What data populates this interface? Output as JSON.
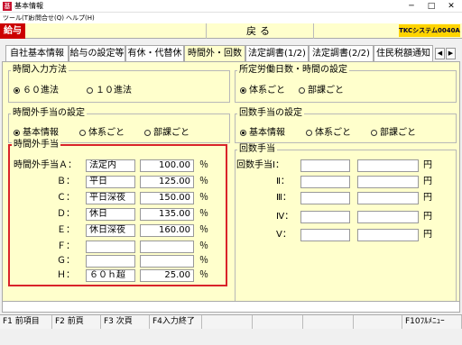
{
  "window": {
    "title": "基本情報",
    "minimize": "─",
    "maximize": "□",
    "close": "✕"
  },
  "menu": {
    "items": [
      "ツール(T)",
      "お問合せ(Q)",
      "ヘルプ(H)"
    ]
  },
  "toolbar": {
    "tag": "給与",
    "back": "戻る",
    "brand": "TKCシステム0040A"
  },
  "tabs": [
    "自社基本情報",
    "給与の設定等",
    "有休・代替休",
    "時間外・回数",
    "法定調書(1/2)",
    "法定調書(2/2)",
    "住民税額通知"
  ],
  "tab_active": "時間外・回数",
  "tab_arrows": {
    "left": "◀",
    "right": "▶"
  },
  "time_input": {
    "title": "時間入力方法",
    "options": [
      {
        "label": "６０進法",
        "selected": true
      },
      {
        "label": "１０進法",
        "selected": false
      }
    ]
  },
  "prescribed": {
    "title": "所定労働日数・時間の設定",
    "options": [
      {
        "label": "体系ごと",
        "selected": true
      },
      {
        "label": "部課ごと",
        "selected": false
      }
    ]
  },
  "overtime_setting": {
    "title": "時間外手当の設定",
    "options": [
      {
        "label": "基本情報",
        "selected": true
      },
      {
        "label": "体系ごと",
        "selected": false
      },
      {
        "label": "部課ごと",
        "selected": false
      }
    ]
  },
  "count_setting": {
    "title": "回数手当の設定",
    "options": [
      {
        "label": "基本情報",
        "selected": true
      },
      {
        "label": "体系ごと",
        "selected": false
      },
      {
        "label": "部課ごと",
        "selected": false
      }
    ]
  },
  "overtime": {
    "title": "時間外手当",
    "rows": [
      {
        "label": "時間外手当Ａ：",
        "name": "法定内",
        "rate": "100.00",
        "unit": "％"
      },
      {
        "label": "Ｂ：",
        "name": "平日",
        "rate": "125.00",
        "unit": "％"
      },
      {
        "label": "Ｃ：",
        "name": "平日深夜",
        "rate": "150.00",
        "unit": "％"
      },
      {
        "label": "Ｄ：",
        "name": "休日",
        "rate": "135.00",
        "unit": "％"
      },
      {
        "label": "Ｅ：",
        "name": "休日深夜",
        "rate": "160.00",
        "unit": "％"
      },
      {
        "label": "Ｆ：",
        "name": "",
        "rate": "",
        "unit": "％"
      },
      {
        "label": "Ｇ：",
        "name": "",
        "rate": "",
        "unit": "％"
      },
      {
        "label": "Ｈ：",
        "name": "６０ｈ超",
        "rate": "25.00",
        "unit": "％"
      }
    ]
  },
  "count_allowance": {
    "title": "回数手当",
    "rows": [
      {
        "label": "回数手当Ⅰ：",
        "name": "",
        "amount": "",
        "unit": "円"
      },
      {
        "label": "Ⅱ：",
        "name": "",
        "amount": "",
        "unit": "円"
      },
      {
        "label": "Ⅲ：",
        "name": "",
        "amount": "",
        "unit": "円"
      },
      {
        "label": "Ⅳ：",
        "name": "",
        "amount": "",
        "unit": "円"
      },
      {
        "label": "Ⅴ：",
        "name": "",
        "amount": "",
        "unit": "円"
      }
    ]
  },
  "fkeys": [
    "F1 前項目",
    "F2 前頁",
    "F3 次頁",
    "F4入力終了",
    "",
    "",
    "",
    "",
    "F10ﾌﾙﾒﾆｭｰ"
  ]
}
